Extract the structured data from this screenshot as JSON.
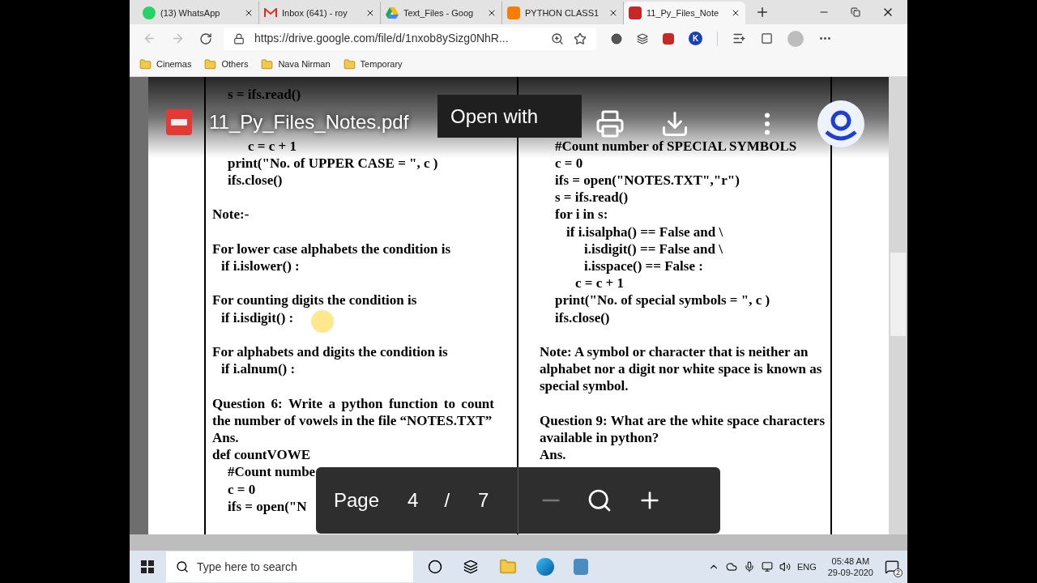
{
  "browser": {
    "tabs": [
      {
        "label": "(13) WhatsApp",
        "selected": false
      },
      {
        "label": "Inbox (641) - roy",
        "selected": false
      },
      {
        "label": "Text_Files - Goog",
        "selected": false
      },
      {
        "label": "PYTHON CLASS1",
        "selected": false
      },
      {
        "label": "11_Py_Files_Note",
        "selected": true
      }
    ],
    "url": "https://drive.google.com/file/d/1nxob8ySizg0NhR...",
    "extension_k": "K",
    "bookmarks": [
      "Cinemas",
      "Others",
      "Nava Nirman",
      "Temporary"
    ]
  },
  "viewer": {
    "file_name": "11_Py_Files_Notes.pdf",
    "open_with": "Open with",
    "page_label": "Page",
    "page": "4",
    "page_sep": "/",
    "page_count": "7",
    "zoom_out_disabled": true
  },
  "document": {
    "left_column": [
      {
        "kind": "i2",
        "text": "s = ifs.read()"
      },
      {
        "kind": "gap"
      },
      {
        "kind": "gap"
      },
      {
        "kind": "i4",
        "text": "c = c + 1"
      },
      {
        "kind": "i2",
        "text": "print(\"No. of UPPER CASE  = \", c )"
      },
      {
        "kind": "i2",
        "text": "ifs.close()"
      },
      {
        "kind": "gap"
      },
      {
        "kind": "text",
        "text": "Note:-"
      },
      {
        "kind": "gap"
      },
      {
        "kind": "text",
        "text": "For lower case alphabets the condition is"
      },
      {
        "kind": "i1",
        "text": "if  i.islower() :"
      },
      {
        "kind": "gap"
      },
      {
        "kind": "text",
        "text": "For counting digits the condition is"
      },
      {
        "kind": "i1",
        "text": "if  i.isdigit() :"
      },
      {
        "kind": "gap"
      },
      {
        "kind": "text",
        "text": "For alphabets and digits the condition is"
      },
      {
        "kind": "i1",
        "text": "if  i.alnum() :"
      },
      {
        "kind": "gap"
      },
      {
        "kind": "para",
        "text": "Question 6:  Write a python function to count the number of vowels in the file “NOTES.TXT”"
      },
      {
        "kind": "text",
        "text": "Ans."
      },
      {
        "kind": "text",
        "text": "def countVOWE"
      },
      {
        "kind": "i2",
        "text": "#Count numbe"
      },
      {
        "kind": "i2",
        "text": "c  =  0"
      },
      {
        "kind": "i2",
        "text": "ifs = open(\"N"
      }
    ],
    "right_column": [
      {
        "kind": "gap"
      },
      {
        "kind": "gap"
      },
      {
        "kind": "gap"
      },
      {
        "kind": "i2",
        "text": "#Count number of SPECIAL SYMBOLS"
      },
      {
        "kind": "i2",
        "text": "c  =  0"
      },
      {
        "kind": "i2",
        "text": "ifs = open(\"NOTES.TXT\",\"r\")"
      },
      {
        "kind": "i2",
        "text": "s = ifs.read()"
      },
      {
        "kind": "i2",
        "text": "for i  in  s:"
      },
      {
        "kind": "i3",
        "text": "if  i.isalpha() == False  and \\"
      },
      {
        "kind": "i5",
        "text": "i.isdigit() == False  and \\"
      },
      {
        "kind": "i5",
        "text": "i.isspace() == False :"
      },
      {
        "kind": "i4",
        "text": "c = c + 1"
      },
      {
        "kind": "i2",
        "text": "print(\"No. of special symbols  = \", c )"
      },
      {
        "kind": "i2",
        "text": "ifs.close()"
      },
      {
        "kind": "gap"
      },
      {
        "kind": "text",
        "text": "Note: A symbol or character that is neither an alphabet nor a digit nor white space is known as special symbol."
      },
      {
        "kind": "gap"
      },
      {
        "kind": "para",
        "text": "Question 9: What are the white space characters  available in python?"
      },
      {
        "kind": "text",
        "text": "Ans."
      }
    ]
  },
  "taskbar": {
    "search_placeholder": "Type here to search",
    "language": "ENG",
    "time": "05:48 AM",
    "date": "29-09-2020",
    "notifications": "2"
  }
}
